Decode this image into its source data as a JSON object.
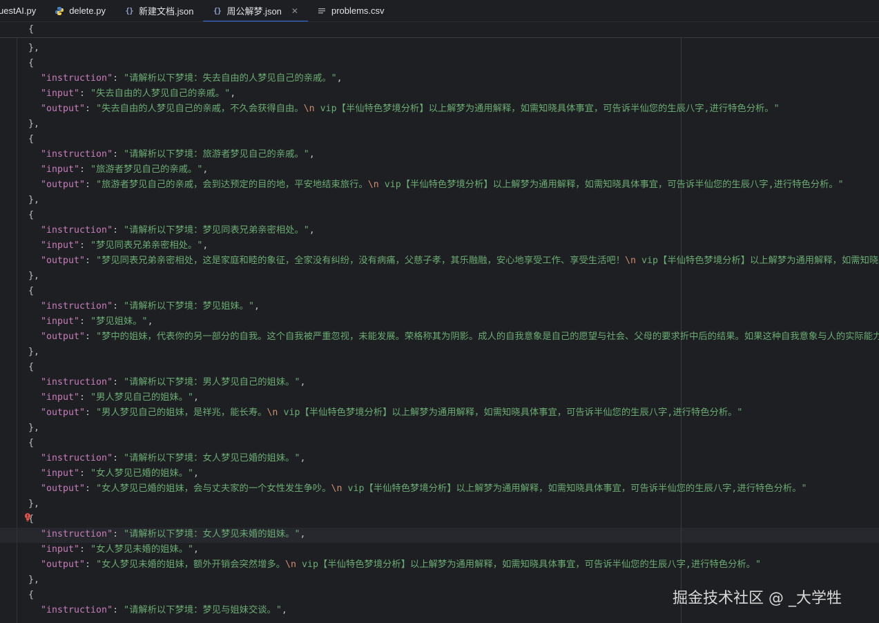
{
  "tabs": [
    {
      "label": "uestAI.py",
      "icon": "python-icon"
    },
    {
      "label": "delete.py",
      "icon": "python-icon"
    },
    {
      "label": "新建文档.json",
      "icon": "json-braces-icon"
    },
    {
      "label": "周公解梦.json",
      "icon": "json-braces-icon",
      "active": true
    },
    {
      "label": "problems.csv",
      "icon": "csv-lines-icon"
    }
  ],
  "code": {
    "open_brace": "{",
    "close_brace_comma": "},",
    "key_instruction": "\"instruction\"",
    "key_input": "\"input\"",
    "key_output": "\"output\"",
    "colon": ": ",
    "comma": ",",
    "escape": "\\n",
    "entries": [
      {
        "instruction": "\"请解析以下梦境：失去自由的人梦见自己的亲戚。\"",
        "input": "\"失去自由的人梦见自己的亲戚。\"",
        "output_a": "\"失去自由的人梦见自己的亲戚，不久会获得自由。",
        "output_b": " vip【半仙特色梦境分析】以上解梦为通用解释，如需知晓具体事宜，可告诉半仙您的生辰八字,进行特色分析。\""
      },
      {
        "instruction": "\"请解析以下梦境：旅游者梦见自己的亲戚。\"",
        "input": "\"旅游者梦见自己的亲戚。\"",
        "output_a": "\"旅游者梦见自己的亲戚，会到达预定的目的地，平安地结束旅行。",
        "output_b": " vip【半仙特色梦境分析】以上解梦为通用解释，如需知晓具体事宜，可告诉半仙您的生辰八字,进行特色分析。\""
      },
      {
        "instruction": "\"请解析以下梦境：梦见同表兄弟亲密相处。\"",
        "input": "\"梦见同表兄弟亲密相处。\"",
        "output_a": "\"梦见同表兄弟亲密相处，这是家庭和睦的象征，全家没有纠纷，没有病痛，父慈子孝，其乐融融，安心地享受工作、享受生活吧！",
        "output_b": " vip【半仙特色梦境分析】以上解梦为通用解释，如需知晓具体"
      },
      {
        "instruction": "\"请解析以下梦境：梦见姐妹。\"",
        "input": "\"梦见姐妹。\"",
        "output_a": "\"梦中的姐妹，代表你的另一部分的自我。这个自我被严重忽视，未能发展。荣格称其为阴影。成人的自我意象是自己的愿望与社会、父母的要求折中后的结果。如果这种自我意象与人的实际能力相符",
        "output_b": ""
      },
      {
        "instruction": "\"请解析以下梦境：男人梦见自己的姐妹。\"",
        "input": "\"男人梦见自己的姐妹。\"",
        "output_a": "\"男人梦见自己的姐妹，是祥兆，能长寿。",
        "output_b": " vip【半仙特色梦境分析】以上解梦为通用解释，如需知晓具体事宜，可告诉半仙您的生辰八字,进行特色分析。\""
      },
      {
        "instruction": "\"请解析以下梦境：女人梦见已婚的姐妹。\"",
        "input": "\"女人梦见已婚的姐妹。\"",
        "output_a": "\"女人梦见已婚的姐妹，会与丈夫家的一个女性发生争吵。",
        "output_b": " vip【半仙特色梦境分析】以上解梦为通用解释，如需知晓具体事宜，可告诉半仙您的生辰八字,进行特色分析。\""
      },
      {
        "instruction": "\"请解析以下梦境：女人梦见未婚的姐妹。\"",
        "input": "\"女人梦见未婚的姐妹。\"",
        "output_a": "\"女人梦见未婚的姐妹，额外开销会突然增多。",
        "output_b": " vip【半仙特色梦境分析】以上解梦为通用解释，如需知晓具体事宜，可告诉半仙您的生辰八字,进行特色分析。\""
      },
      {
        "instruction": "\"请解析以下梦境：梦见与姐妹交谈。\"",
        "input": "",
        "output_a": "",
        "output_b": ""
      }
    ]
  },
  "watermark": "掘金技术社区 @ _大学牲",
  "colors": {
    "background": "#1e1f22",
    "key": "#c77dbb",
    "string": "#6aab73",
    "escape": "#cf8e6d",
    "punctuation": "#bcbec4",
    "active_tab_underline": "#3574f0"
  }
}
